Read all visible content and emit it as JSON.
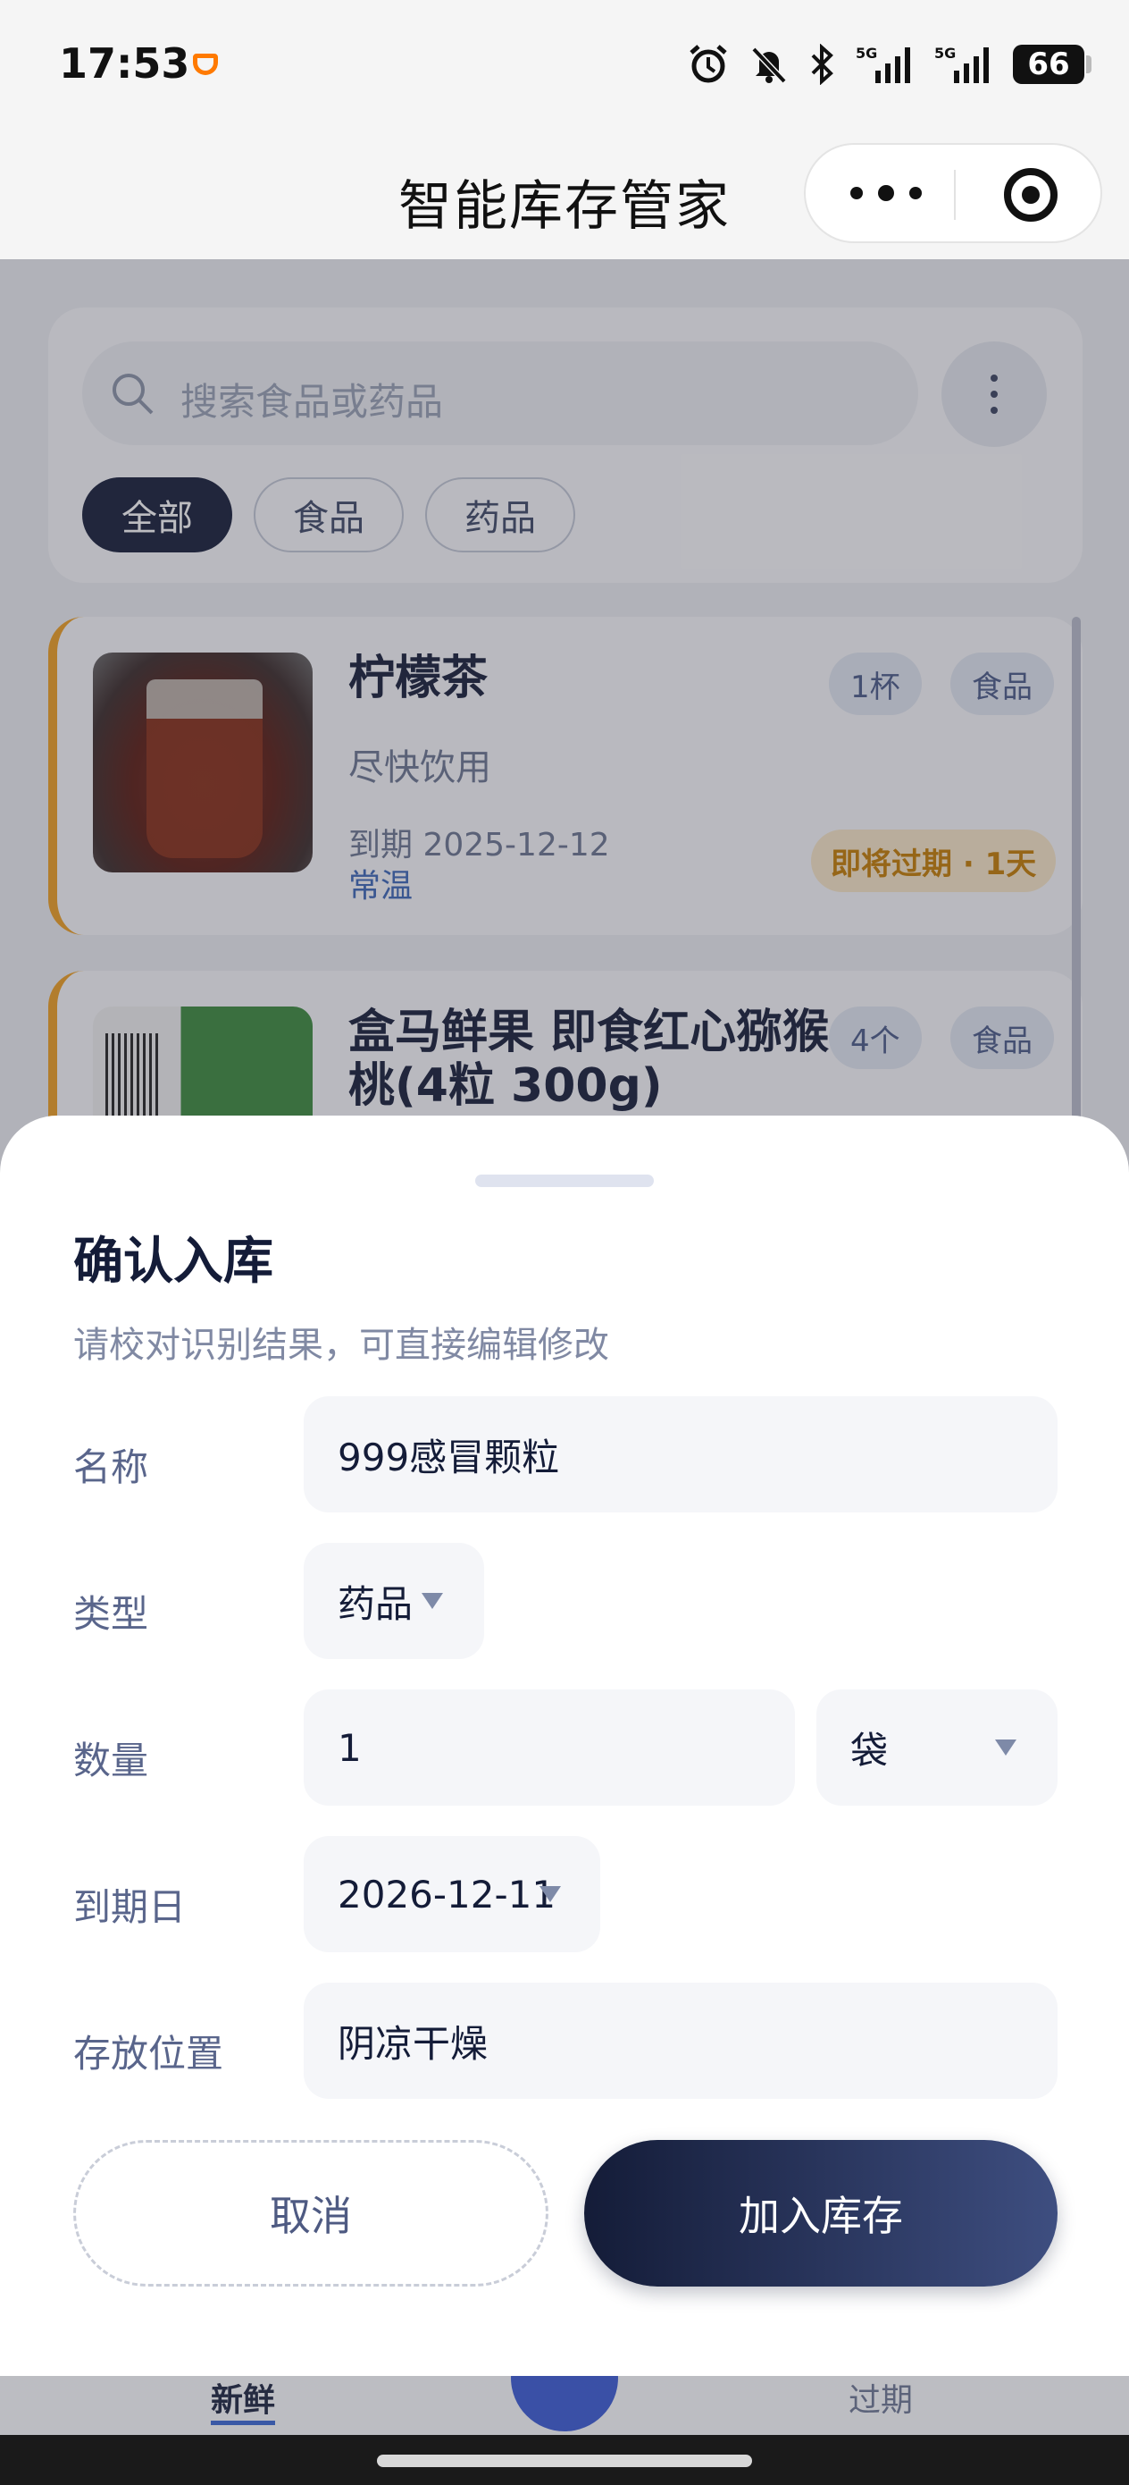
{
  "status_bar": {
    "time": "17:53",
    "battery": "66"
  },
  "nav": {
    "title": "智能库存管家"
  },
  "search": {
    "placeholder": "搜索食品或药品"
  },
  "filters": [
    {
      "label": "全部",
      "active": true
    },
    {
      "label": "食品",
      "active": false
    },
    {
      "label": "药品",
      "active": false
    }
  ],
  "items": [
    {
      "name": "柠檬茶",
      "tip": "尽快饮用",
      "quantity": "1杯",
      "category": "食品",
      "expiry": "到期 2025-12-12",
      "storage": "常温",
      "status": "即将过期 · 1天"
    },
    {
      "name": "盒马鲜果 即食红心猕猴桃(4粒 300g)",
      "quantity": "4个",
      "category": "食品"
    }
  ],
  "sheet": {
    "title": "确认入库",
    "subtitle": "请校对识别结果，可直接编辑修改",
    "fields": {
      "name": {
        "label": "名称",
        "value": "999感冒颗粒"
      },
      "type": {
        "label": "类型",
        "value": "药品"
      },
      "quantity": {
        "label": "数量",
        "value": "1",
        "unit": "袋"
      },
      "expiry": {
        "label": "到期日",
        "value": "2026-12-11"
      },
      "location": {
        "label": "存放位置",
        "value": "阴凉干燥"
      }
    },
    "cancel_label": "取消",
    "confirm_label": "加入库存"
  },
  "tabbar": {
    "fresh": "新鲜",
    "expired": "过期"
  },
  "colors": {
    "primary": "#141c38",
    "warning": "#f0a020",
    "accent": "#3a5ad0"
  }
}
